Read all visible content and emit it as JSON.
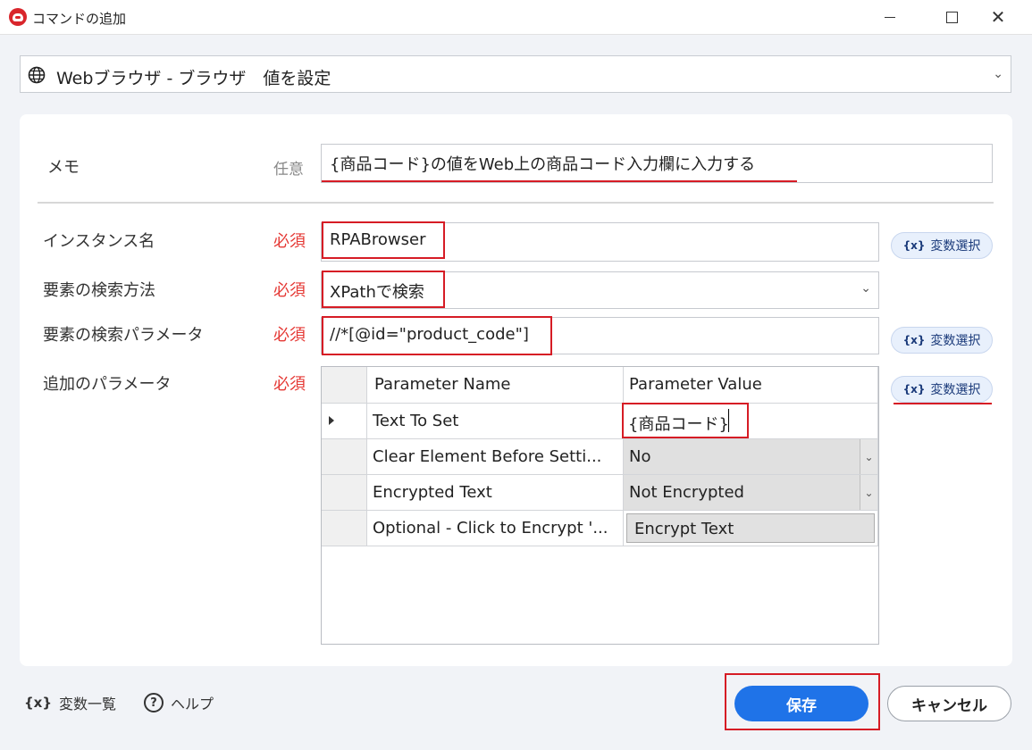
{
  "window": {
    "title": "コマンドの追加",
    "minimize": "—",
    "maximize": "☐",
    "close": "✕"
  },
  "command": {
    "icon": "globe-icon",
    "label": "Webブラウザ - ブラウザ　値を設定",
    "chevron": "⌄"
  },
  "fields": {
    "memo": {
      "label": "メモ",
      "badge": "任意",
      "value": "{商品コード}の値をWeb上の商品コード入力欄に入力する"
    },
    "instance": {
      "label": "インスタンス名",
      "badge": "必須",
      "value": "RPABrowser"
    },
    "search_method": {
      "label": "要素の検索方法",
      "badge": "必須",
      "value": "XPathで検索"
    },
    "search_param": {
      "label": "要素の検索パラメータ",
      "badge": "必須",
      "value": "//*[@id=\"product_code\"]"
    },
    "extra_params": {
      "label": "追加のパラメータ",
      "badge": "必須"
    }
  },
  "var_button": {
    "icon": "{x}",
    "label": "変数選択"
  },
  "param_table": {
    "headers": [
      "Parameter Name",
      "Parameter Value"
    ],
    "rows": [
      {
        "name": "Text To Set",
        "value": "{商品コード}"
      },
      {
        "name": "Clear Element Before Setti...",
        "value": "No"
      },
      {
        "name": "Encrypted Text",
        "value": "Not Encrypted"
      },
      {
        "name": "Optional - Click to Encrypt '...",
        "value": "Encrypt Text"
      }
    ]
  },
  "footer": {
    "var_list_icon": "{x}",
    "var_list": "変数一覧",
    "help_icon": "?",
    "help": "ヘルプ",
    "save": "保存",
    "cancel": "キャンセル"
  },
  "colors": {
    "required": "#e53935",
    "accent": "#1f73e8",
    "highlight": "#d61c25"
  }
}
